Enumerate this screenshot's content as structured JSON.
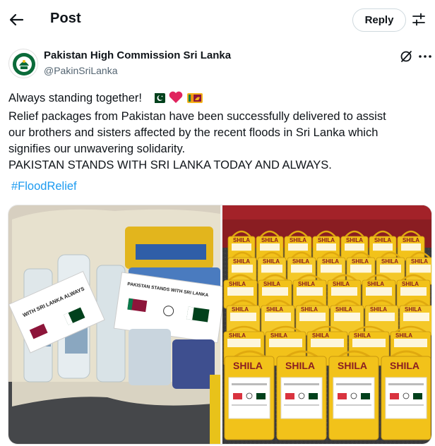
{
  "header": {
    "title": "Post",
    "reply_label": "Reply",
    "back_icon": "arrow-left-icon",
    "settings_icon": "sliders-icon"
  },
  "author": {
    "name": "Pakistan High Commission Sri Lanka",
    "handle": "@PakinSriLanka",
    "avatar_icon": "emblem-avatar"
  },
  "post": {
    "line1": "Always standing together!",
    "line2": "Relief packages from Pakistan have been successfully delivered to assist",
    "line3": "our brothers and sisters affected by the recent floods in Sri Lanka which",
    "line4": "signifies our unwavering solidarity.",
    "line5": "PAKISTAN STANDS WITH SRI LANKA TODAY AND ALWAYS.",
    "hashtag": "#FloodRelief",
    "emojis": [
      "pakistan-flag",
      "red-heart",
      "sri-lanka-flag"
    ]
  },
  "media": {
    "left_card_text": "WITH SRI LANKA ALWAYS",
    "right_label_text": "PAKISTAN STANDS WITH SRI LANKA TODAY AND ALWAYS",
    "bag_brand": "SHILA"
  },
  "colors": {
    "accent": "#1d9bf0",
    "text": "#0f1419",
    "secondary": "#536471",
    "bag_yellow": "#f2c21a",
    "bag_red": "#d9333f"
  }
}
